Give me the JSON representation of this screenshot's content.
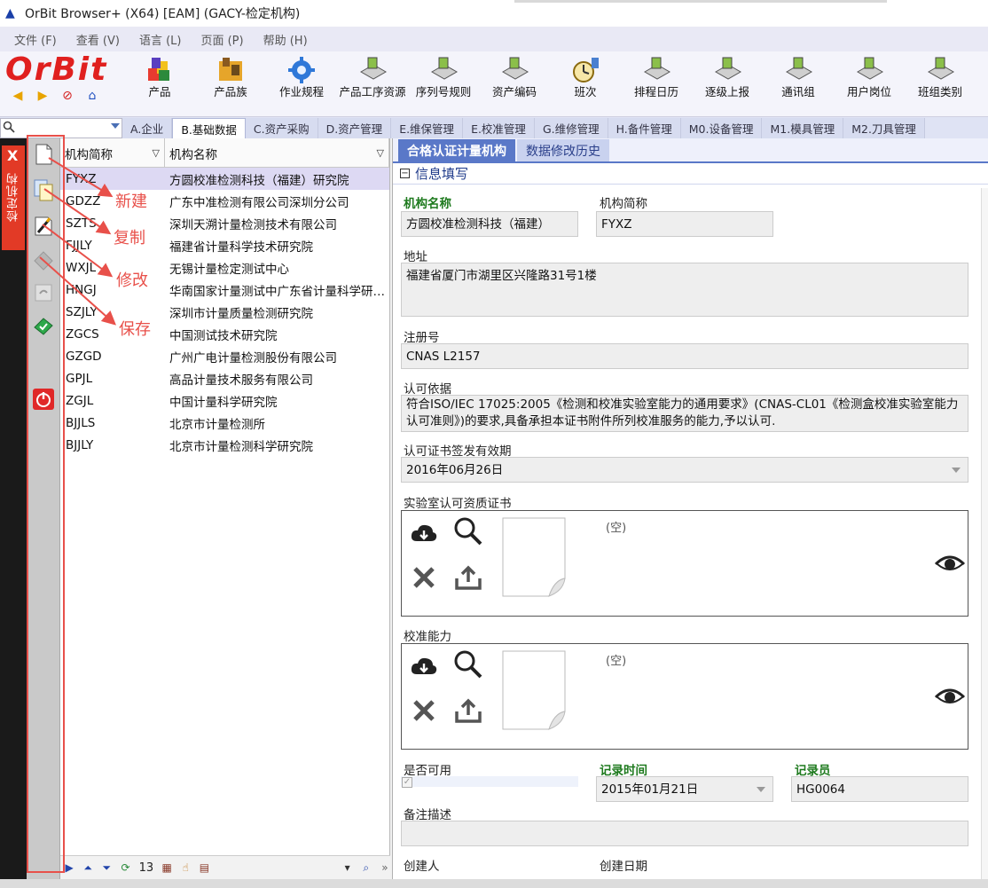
{
  "window": {
    "title": "OrBit Browser+ (X64) [EAM] (GACY-检定机构)"
  },
  "menu": [
    "文件 (F)",
    "查看 (V)",
    "语言 (L)",
    "页面 (P)",
    "帮助 (H)"
  ],
  "logo": {
    "text": "OrBit"
  },
  "toolbar": [
    {
      "label": "产品",
      "icon": "product-icon"
    },
    {
      "label": "产品族",
      "icon": "product-family-icon"
    },
    {
      "label": "作业规程",
      "icon": "gear-icon"
    },
    {
      "label": "产品工序资源",
      "icon": "process-resource-icon"
    },
    {
      "label": "序列号规则",
      "icon": "serial-rule-icon"
    },
    {
      "label": "资产编码",
      "icon": "asset-code-icon"
    },
    {
      "label": "班次",
      "icon": "clock-icon"
    },
    {
      "label": "排程日历",
      "icon": "calendar-icon"
    },
    {
      "label": "逐级上报",
      "icon": "report-icon"
    },
    {
      "label": "通讯组",
      "icon": "comm-group-icon"
    },
    {
      "label": "用户岗位",
      "icon": "user-post-icon"
    },
    {
      "label": "班组类别",
      "icon": "team-type-icon"
    }
  ],
  "module_tabs": [
    {
      "label": "A.企业",
      "active": false
    },
    {
      "label": "B.基础数据",
      "active": true
    },
    {
      "label": "C.资产采购",
      "active": false
    },
    {
      "label": "D.资产管理",
      "active": false
    },
    {
      "label": "E.维保管理",
      "active": false
    },
    {
      "label": "E.校准管理",
      "active": false
    },
    {
      "label": "G.维修管理",
      "active": false
    },
    {
      "label": "H.备件管理",
      "active": false
    },
    {
      "label": "M0.设备管理",
      "active": false
    },
    {
      "label": "M1.模具管理",
      "active": false
    },
    {
      "label": "M2.刀具管理",
      "active": false
    }
  ],
  "side_tab": {
    "close": "X",
    "label": "检定机构"
  },
  "annotations": {
    "new": "新建",
    "copy": "复制",
    "edit": "修改",
    "save": "保存"
  },
  "list": {
    "columns": [
      "机构简称",
      "机构名称"
    ],
    "rows": [
      {
        "code": "FYXZ",
        "name": "方圆校准检测科技（福建）研究院",
        "selected": true
      },
      {
        "code": "GDZZ",
        "name": "广东中准检测有限公司深圳分公司"
      },
      {
        "code": "SZTS",
        "name": "深圳天溯计量检测技术有限公司"
      },
      {
        "code": "FJJLY",
        "name": "福建省计量科学技术研究院"
      },
      {
        "code": "WXJL",
        "name": "无锡计量检定测试中心"
      },
      {
        "code": "HNGJ",
        "name": "华南国家计量测试中广东省计量科学研究院"
      },
      {
        "code": "SZJLY",
        "name": "深圳市计量质量检测研究院"
      },
      {
        "code": "ZGCS",
        "name": "中国测试技术研究院"
      },
      {
        "code": "GZGD",
        "name": "广州广电计量检测股份有限公司"
      },
      {
        "code": "GPJL",
        "name": "高品计量技术服务有限公司"
      },
      {
        "code": "ZGJL",
        "name": "中国计量科学研究院"
      },
      {
        "code": "BJJLS",
        "name": "北京市计量检测所"
      },
      {
        "code": "BJJLY",
        "name": "北京市计量检测科学研究院"
      }
    ],
    "count": "13"
  },
  "detail": {
    "tabs": [
      {
        "label": "合格认证计量机构",
        "active": true
      },
      {
        "label": "数据修改历史",
        "active": false
      }
    ],
    "section": "信息填写",
    "fields": {
      "org_name": {
        "label": "机构名称",
        "value": "方圆校准检测科技（福建）"
      },
      "org_short": {
        "label": "机构简称",
        "value": "FYXZ"
      },
      "address": {
        "label": "地址",
        "value": "福建省厦门市湖里区兴隆路31号1楼"
      },
      "reg_no": {
        "label": "注册号",
        "value": "CNAS L2157"
      },
      "basis": {
        "label": "认可依据",
        "value": "符合ISO/IEC  17025:2005《检测和校准实验室能力的通用要求》(CNAS-CL01《检测盒校准实验室能力认可准则》)的要求,具备承担本证书附件所列校准服务的能力,予以认可."
      },
      "validity": {
        "label": "认可证书签发有效期",
        "value": "2016年06月26日"
      },
      "lab_cert": {
        "label": "实验室认可资质证书",
        "empty": "(空)"
      },
      "calib": {
        "label": "校准能力",
        "empty": "(空)"
      },
      "enabled": {
        "label": "是否可用"
      },
      "record_time": {
        "label": "记录时间",
        "value": "2015年01月21日"
      },
      "recorder": {
        "label": "记录员",
        "value": "HG0064"
      },
      "remark": {
        "label": "备注描述",
        "value": ""
      },
      "creator": {
        "label": "创建人"
      },
      "create_date": {
        "label": "创建日期"
      }
    }
  }
}
